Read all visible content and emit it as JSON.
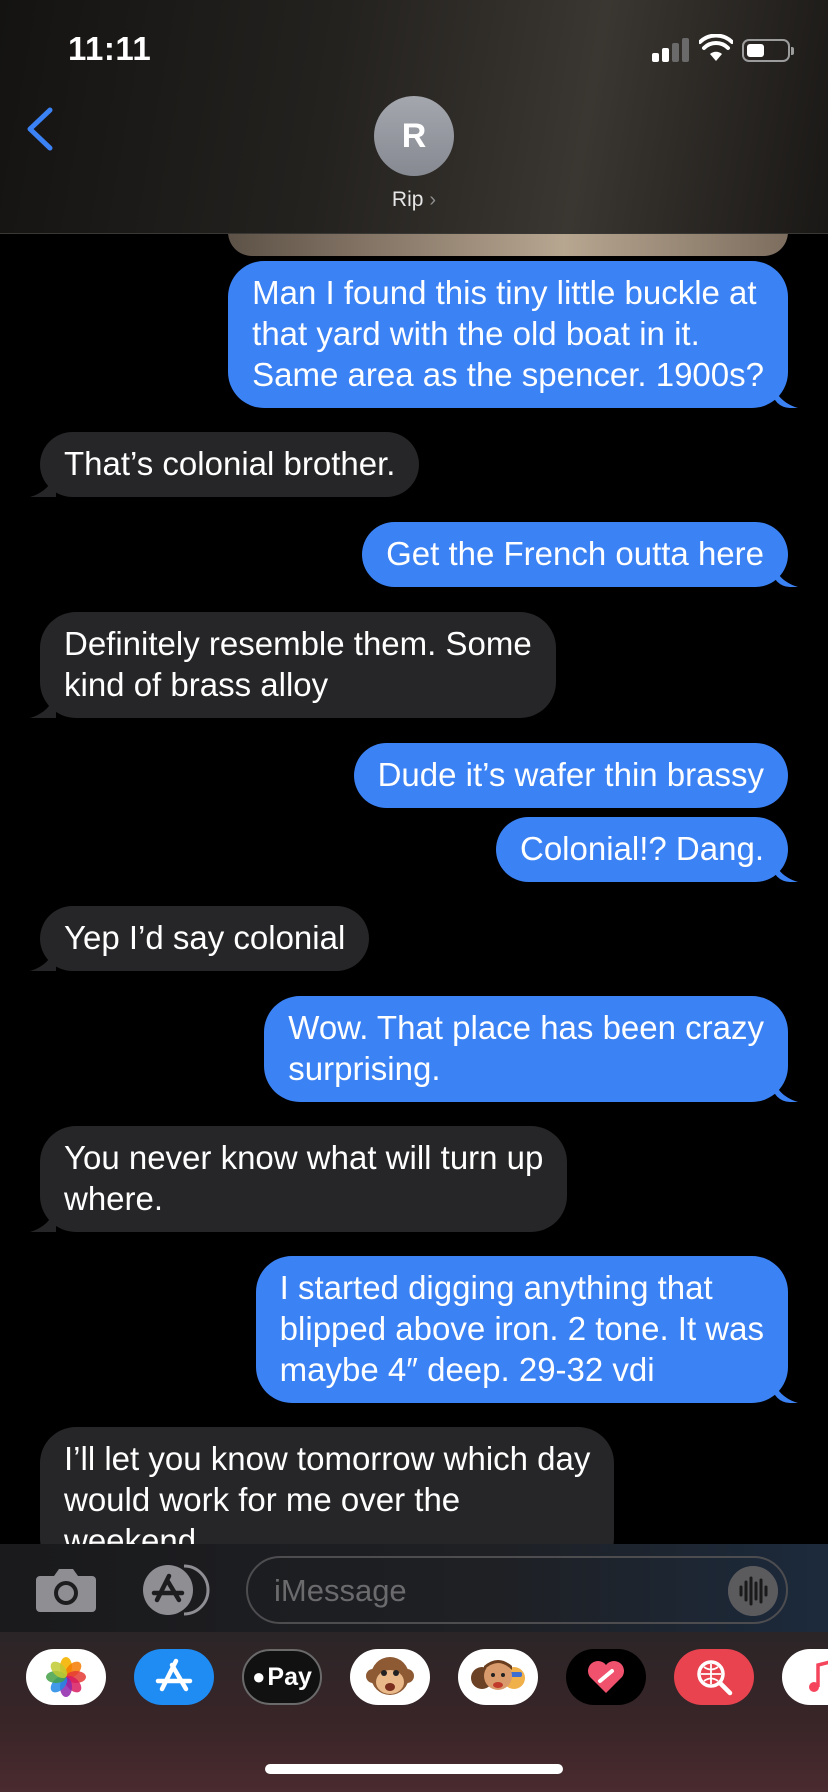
{
  "status_bar": {
    "time": "11:11"
  },
  "contact": {
    "initial": "R",
    "name": "Rip",
    "chevron": "›"
  },
  "messages": [
    {
      "from": "me",
      "lines": [
        "Man I found this tiny little buckle at",
        "that yard with the old boat in it.",
        "Same area as the spencer. 1900s?"
      ]
    },
    {
      "from": "them",
      "lines": [
        "That’s colonial brother."
      ]
    },
    {
      "from": "me",
      "lines": [
        "Get the French outta here"
      ]
    },
    {
      "from": "them",
      "lines": [
        "Definitely resemble them. Some",
        "kind of brass alloy"
      ]
    },
    {
      "from": "me",
      "lines": [
        "Dude it’s wafer thin brassy"
      ]
    },
    {
      "from": "me",
      "lines": [
        "Colonial!? Dang."
      ]
    },
    {
      "from": "them",
      "lines": [
        "Yep I’d say colonial"
      ]
    },
    {
      "from": "me",
      "lines": [
        "Wow. That place has been crazy",
        "surprising."
      ]
    },
    {
      "from": "them",
      "lines": [
        "You never know what will turn up",
        "where."
      ]
    },
    {
      "from": "me",
      "lines": [
        "I started digging anything that",
        "blipped above iron. 2 tone. It was",
        "maybe 4″ deep. 29-32 vdi"
      ]
    },
    {
      "from": "them",
      "lines": [
        "I’ll let you know tomorrow which day",
        "would work for me over the",
        "weekend"
      ]
    }
  ],
  "compose": {
    "placeholder": "iMessage"
  },
  "app_drawer": {
    "apple_pay_label": "Pay",
    "apps": [
      "photos-icon",
      "app-store-icon",
      "apple-pay-icon",
      "animoji-icon",
      "memoji-icon",
      "digital-touch-icon",
      "search-images-icon",
      "music-icon"
    ]
  },
  "colors": {
    "sent_bubble": "#3b82f5",
    "received_bubble": "#262628",
    "accent": "#3b82f5"
  }
}
